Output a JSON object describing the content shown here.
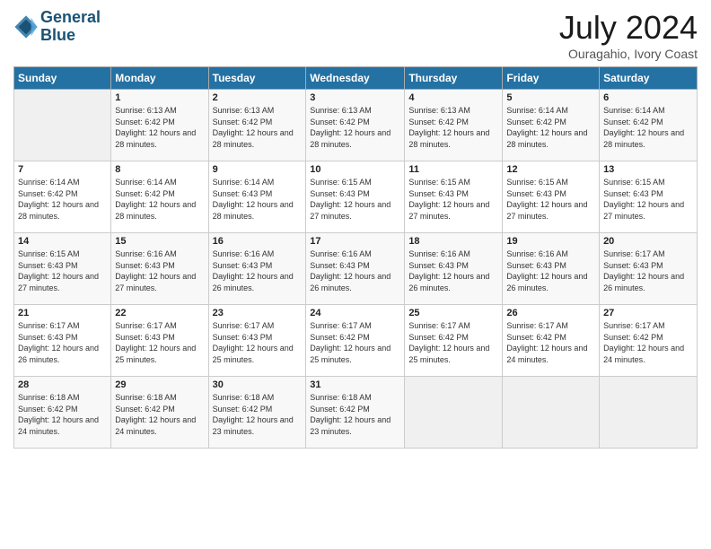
{
  "header": {
    "logo_line1": "General",
    "logo_line2": "Blue",
    "month": "July 2024",
    "location": "Ouragahio, Ivory Coast"
  },
  "weekdays": [
    "Sunday",
    "Monday",
    "Tuesday",
    "Wednesday",
    "Thursday",
    "Friday",
    "Saturday"
  ],
  "weeks": [
    [
      {
        "day": "",
        "sunrise": "",
        "sunset": "",
        "daylight": ""
      },
      {
        "day": "1",
        "sunrise": "6:13 AM",
        "sunset": "6:42 PM",
        "daylight": "12 hours and 28 minutes."
      },
      {
        "day": "2",
        "sunrise": "6:13 AM",
        "sunset": "6:42 PM",
        "daylight": "12 hours and 28 minutes."
      },
      {
        "day": "3",
        "sunrise": "6:13 AM",
        "sunset": "6:42 PM",
        "daylight": "12 hours and 28 minutes."
      },
      {
        "day": "4",
        "sunrise": "6:13 AM",
        "sunset": "6:42 PM",
        "daylight": "12 hours and 28 minutes."
      },
      {
        "day": "5",
        "sunrise": "6:14 AM",
        "sunset": "6:42 PM",
        "daylight": "12 hours and 28 minutes."
      },
      {
        "day": "6",
        "sunrise": "6:14 AM",
        "sunset": "6:42 PM",
        "daylight": "12 hours and 28 minutes."
      }
    ],
    [
      {
        "day": "7",
        "sunrise": "6:14 AM",
        "sunset": "6:42 PM",
        "daylight": "12 hours and 28 minutes."
      },
      {
        "day": "8",
        "sunrise": "6:14 AM",
        "sunset": "6:42 PM",
        "daylight": "12 hours and 28 minutes."
      },
      {
        "day": "9",
        "sunrise": "6:14 AM",
        "sunset": "6:43 PM",
        "daylight": "12 hours and 28 minutes."
      },
      {
        "day": "10",
        "sunrise": "6:15 AM",
        "sunset": "6:43 PM",
        "daylight": "12 hours and 27 minutes."
      },
      {
        "day": "11",
        "sunrise": "6:15 AM",
        "sunset": "6:43 PM",
        "daylight": "12 hours and 27 minutes."
      },
      {
        "day": "12",
        "sunrise": "6:15 AM",
        "sunset": "6:43 PM",
        "daylight": "12 hours and 27 minutes."
      },
      {
        "day": "13",
        "sunrise": "6:15 AM",
        "sunset": "6:43 PM",
        "daylight": "12 hours and 27 minutes."
      }
    ],
    [
      {
        "day": "14",
        "sunrise": "6:15 AM",
        "sunset": "6:43 PM",
        "daylight": "12 hours and 27 minutes."
      },
      {
        "day": "15",
        "sunrise": "6:16 AM",
        "sunset": "6:43 PM",
        "daylight": "12 hours and 27 minutes."
      },
      {
        "day": "16",
        "sunrise": "6:16 AM",
        "sunset": "6:43 PM",
        "daylight": "12 hours and 26 minutes."
      },
      {
        "day": "17",
        "sunrise": "6:16 AM",
        "sunset": "6:43 PM",
        "daylight": "12 hours and 26 minutes."
      },
      {
        "day": "18",
        "sunrise": "6:16 AM",
        "sunset": "6:43 PM",
        "daylight": "12 hours and 26 minutes."
      },
      {
        "day": "19",
        "sunrise": "6:16 AM",
        "sunset": "6:43 PM",
        "daylight": "12 hours and 26 minutes."
      },
      {
        "day": "20",
        "sunrise": "6:17 AM",
        "sunset": "6:43 PM",
        "daylight": "12 hours and 26 minutes."
      }
    ],
    [
      {
        "day": "21",
        "sunrise": "6:17 AM",
        "sunset": "6:43 PM",
        "daylight": "12 hours and 26 minutes."
      },
      {
        "day": "22",
        "sunrise": "6:17 AM",
        "sunset": "6:43 PM",
        "daylight": "12 hours and 25 minutes."
      },
      {
        "day": "23",
        "sunrise": "6:17 AM",
        "sunset": "6:43 PM",
        "daylight": "12 hours and 25 minutes."
      },
      {
        "day": "24",
        "sunrise": "6:17 AM",
        "sunset": "6:42 PM",
        "daylight": "12 hours and 25 minutes."
      },
      {
        "day": "25",
        "sunrise": "6:17 AM",
        "sunset": "6:42 PM",
        "daylight": "12 hours and 25 minutes."
      },
      {
        "day": "26",
        "sunrise": "6:17 AM",
        "sunset": "6:42 PM",
        "daylight": "12 hours and 24 minutes."
      },
      {
        "day": "27",
        "sunrise": "6:17 AM",
        "sunset": "6:42 PM",
        "daylight": "12 hours and 24 minutes."
      }
    ],
    [
      {
        "day": "28",
        "sunrise": "6:18 AM",
        "sunset": "6:42 PM",
        "daylight": "12 hours and 24 minutes."
      },
      {
        "day": "29",
        "sunrise": "6:18 AM",
        "sunset": "6:42 PM",
        "daylight": "12 hours and 24 minutes."
      },
      {
        "day": "30",
        "sunrise": "6:18 AM",
        "sunset": "6:42 PM",
        "daylight": "12 hours and 23 minutes."
      },
      {
        "day": "31",
        "sunrise": "6:18 AM",
        "sunset": "6:42 PM",
        "daylight": "12 hours and 23 minutes."
      },
      {
        "day": "",
        "sunrise": "",
        "sunset": "",
        "daylight": ""
      },
      {
        "day": "",
        "sunrise": "",
        "sunset": "",
        "daylight": ""
      },
      {
        "day": "",
        "sunrise": "",
        "sunset": "",
        "daylight": ""
      }
    ]
  ]
}
